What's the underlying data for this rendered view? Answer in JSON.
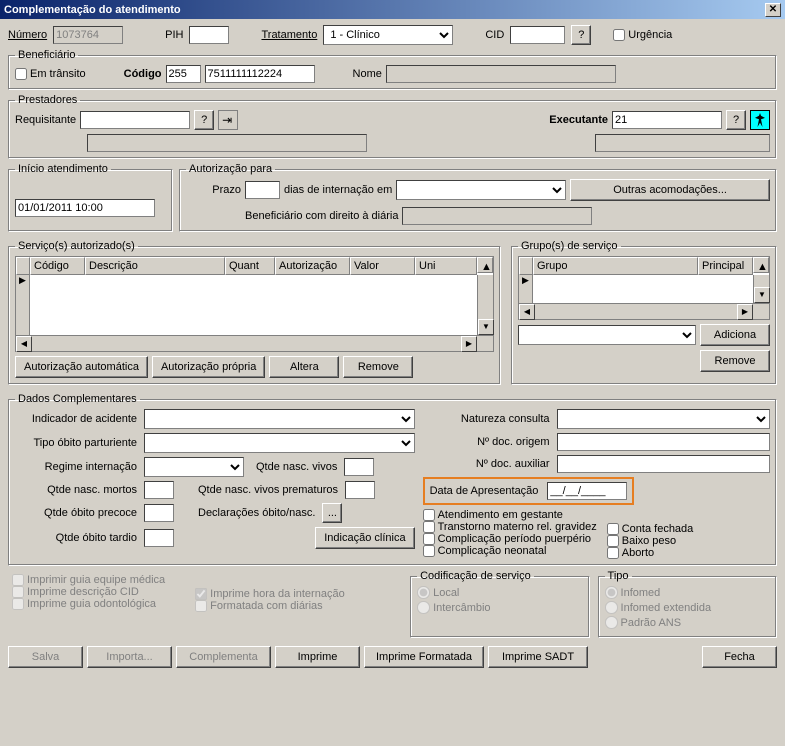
{
  "title": "Complementação do atendimento",
  "top": {
    "numero_label": "Número",
    "numero_value": "1073764",
    "pih_label": "PIH",
    "pih_value": "",
    "tratamento_label": "Tratamento",
    "tratamento_value": "1 - Clínico",
    "cid_label": "CID",
    "cid_value": "",
    "help_label": "?",
    "urgencia_label": "Urgência"
  },
  "beneficiario": {
    "legend": "Beneficiário",
    "transito_label": "Em trânsito",
    "codigo_label": "Código",
    "codigo1": "255",
    "codigo2": "7511111112224",
    "nome_label": "Nome",
    "nome_value": ""
  },
  "prestadores": {
    "legend": "Prestadores",
    "requisitante_label": "Requisitante",
    "requisitante_value": "",
    "help_label": "?",
    "executante_label": "Executante",
    "executante_value": "21",
    "help2_label": "?",
    "req_desc": "",
    "exec_desc": ""
  },
  "inicio": {
    "legend": "Início atendimento",
    "value": "01/01/2011 10:00"
  },
  "autorizacao": {
    "legend": "Autorização para",
    "prazo_label": "Prazo",
    "prazo_value": "",
    "dias_label": "dias de internação em",
    "acomodacao_value": "",
    "outras_label": "Outras acomodações...",
    "benef_diaria_label": "Beneficiário com direito à diária"
  },
  "servicos": {
    "legend": "Serviço(s) autorizado(s)",
    "headers": [
      "Código",
      "Descrição",
      "Quant",
      "Autorização",
      "Valor",
      "Uni"
    ],
    "btn_auto": "Autorização automática",
    "btn_propria": "Autorização própria",
    "btn_altera": "Altera",
    "btn_remove": "Remove"
  },
  "grupos": {
    "legend": "Grupo(s) de serviço",
    "headers": [
      "Grupo",
      "Principal"
    ],
    "btn_adiciona": "Adiciona",
    "btn_remove": "Remove",
    "combo_value": ""
  },
  "dados": {
    "legend": "Dados Complementares",
    "indicador_label": "Indicador de acidente",
    "tipo_obito_label": "Tipo óbito parturiente",
    "regime_label": "Regime internação",
    "qtde_nasc_vivos_label": "Qtde nasc. vivos",
    "qtde_nasc_mortos_label": "Qtde nasc. mortos",
    "qtde_nasc_prematuros_label": "Qtde nasc. vivos prematuros",
    "qtde_obito_precoce_label": "Qtde óbito precoce",
    "decl_obito_label": "Declarações óbito/nasc.",
    "decl_btn": "...",
    "qtde_obito_tardio_label": "Qtde óbito tardio",
    "indicacao_btn": "Indicação clínica",
    "natureza_label": "Natureza consulta",
    "doc_origem_label": "Nº doc. origem",
    "doc_aux_label": "Nº doc. auxiliar",
    "data_apres_label": "Data de Apresentação",
    "data_apres_value": "__/__/____",
    "chk_gestante": "Atendimento em gestante",
    "chk_transtorno": "Transtorno materno  rel. gravidez",
    "chk_puerperio": "Complicação período puerpério",
    "chk_neonatal": "Complicação neonatal",
    "chk_conta_fechada": "Conta fechada",
    "chk_baixo_peso": "Baixo peso",
    "chk_aborto": "Aborto"
  },
  "print_opts": {
    "guia_medica": "Imprimir guia equipe médica",
    "desc_cid": "Imprime descrição CID",
    "guia_odonto": "Imprime guia odontológica",
    "hora_intern": "Imprime hora da internação",
    "formatada": "Formatada com diárias"
  },
  "codificacao": {
    "legend": "Codificação de serviço",
    "local": "Local",
    "intercambio": "Intercâmbio"
  },
  "tipo": {
    "legend": "Tipo",
    "infomed": "Infomed",
    "extendida": "Infomed extendida",
    "ans": "Padrão ANS"
  },
  "buttons": {
    "salva": "Salva",
    "importa": "Importa...",
    "complementa": "Complementa",
    "imprime": "Imprime",
    "imprime_formatada": "Imprime Formatada",
    "imprime_sadt": "Imprime SADT",
    "fecha": "Fecha"
  }
}
